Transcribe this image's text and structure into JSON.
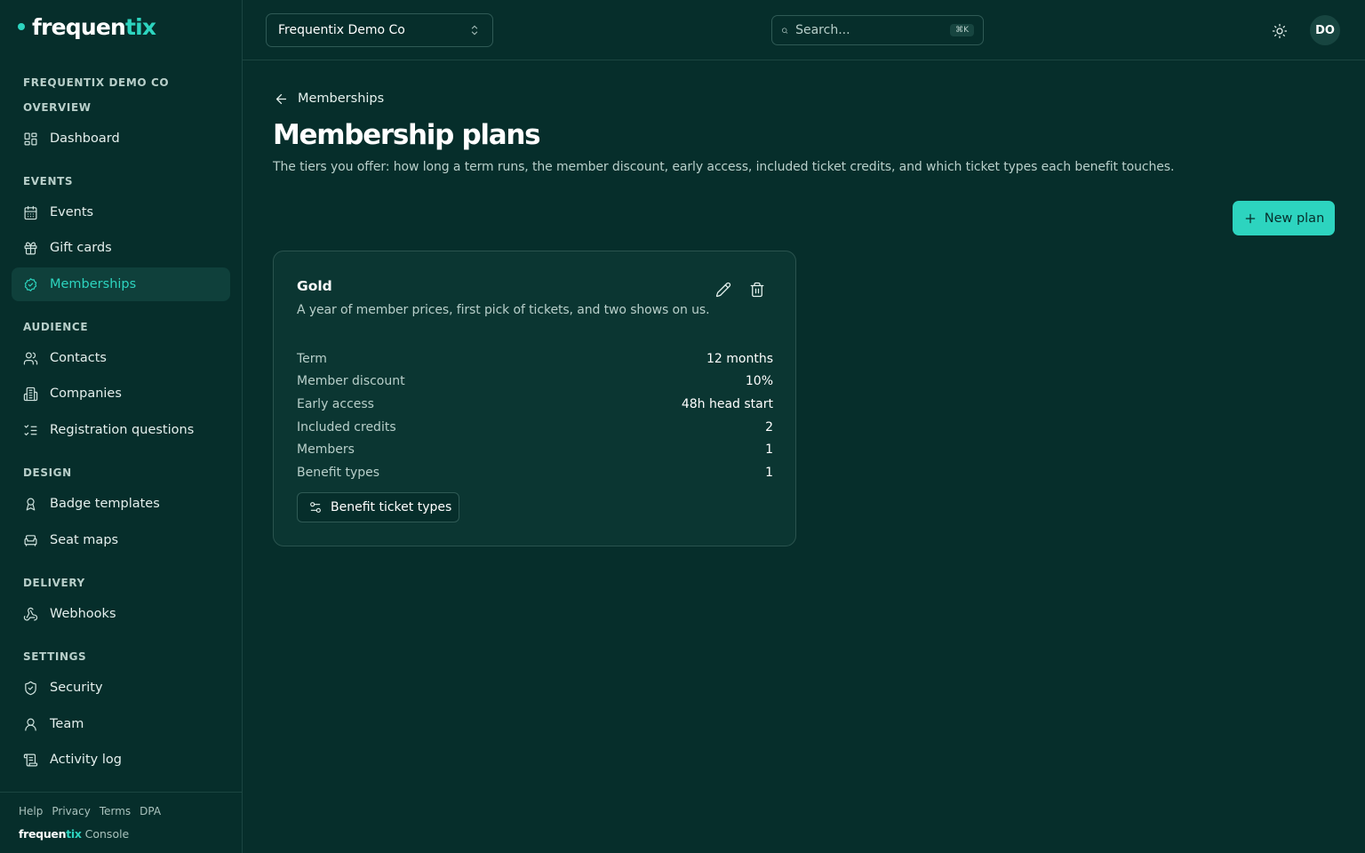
{
  "brand": {
    "name_main": "frequen",
    "name_accent": "tix",
    "accent_color": "#2dd4bf"
  },
  "sidebar": {
    "org_heading": "FREQUENTIX DEMO CO",
    "sections": [
      {
        "label": "OVERVIEW",
        "items": [
          {
            "label": "Dashboard",
            "icon": "dashboard-icon"
          }
        ]
      },
      {
        "label": "EVENTS",
        "items": [
          {
            "label": "Events",
            "icon": "calendar-icon"
          },
          {
            "label": "Gift cards",
            "icon": "gift-icon"
          },
          {
            "label": "Memberships",
            "icon": "badge-check-icon",
            "active": true
          }
        ]
      },
      {
        "label": "AUDIENCE",
        "items": [
          {
            "label": "Contacts",
            "icon": "users-icon"
          },
          {
            "label": "Companies",
            "icon": "building-icon"
          },
          {
            "label": "Registration questions",
            "icon": "list-checks-icon"
          }
        ]
      },
      {
        "label": "DESIGN",
        "items": [
          {
            "label": "Badge templates",
            "icon": "ribbon-icon"
          },
          {
            "label": "Seat maps",
            "icon": "armchair-icon"
          }
        ]
      },
      {
        "label": "DELIVERY",
        "items": [
          {
            "label": "Webhooks",
            "icon": "webhook-icon"
          }
        ]
      },
      {
        "label": "SETTINGS",
        "items": [
          {
            "label": "Security",
            "icon": "shield-check-icon"
          },
          {
            "label": "Team",
            "icon": "user-icon"
          },
          {
            "label": "Activity log",
            "icon": "scroll-icon"
          }
        ]
      }
    ],
    "footer": {
      "links": [
        "Help",
        "Privacy",
        "Terms",
        "DPA"
      ],
      "brand_main": "frequen",
      "brand_accent": "tix",
      "brand_suffix": " Console"
    }
  },
  "topbar": {
    "org_select": "Frequentix Demo Co",
    "search_placeholder": "Search...",
    "search_shortcut": "⌘K",
    "theme_icon": "sun-icon",
    "avatar_initials": "DO"
  },
  "main": {
    "back_label": "Memberships",
    "title": "Membership plans",
    "description": "The tiers you offer: how long a term runs, the member discount, early access, included ticket credits, and which ticket types each benefit touches.",
    "new_plan_label": "New plan"
  },
  "plan": {
    "name": "Gold",
    "description": "A year of member prices, first pick of tickets, and two shows on us.",
    "stats": [
      {
        "label": "Term",
        "value": "12 months"
      },
      {
        "label": "Member discount",
        "value": "10%"
      },
      {
        "label": "Early access",
        "value": "48h head start"
      },
      {
        "label": "Included credits",
        "value": "2"
      },
      {
        "label": "Members",
        "value": "1"
      },
      {
        "label": "Benefit types",
        "value": "1"
      }
    ],
    "benefit_button_label": "Benefit ticket types"
  }
}
